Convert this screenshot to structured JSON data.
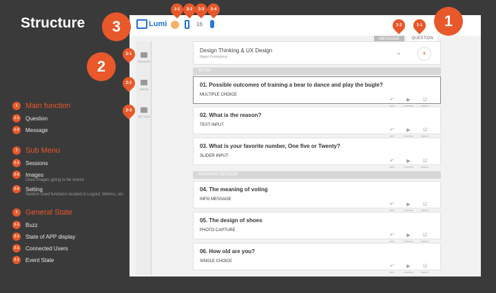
{
  "title": "Structure",
  "markers": {
    "big1": "1",
    "big2": "2",
    "big3": "3",
    "pins": [
      "1-2",
      "1-1",
      "2-1",
      "2-2",
      "2-3",
      "3-1",
      "3-2",
      "3-3",
      "3-4"
    ]
  },
  "legend": {
    "main": {
      "num": "1",
      "title": "Main function",
      "items": [
        {
          "num": "1-1",
          "label": "Question",
          "sub": ""
        },
        {
          "num": "1-2",
          "label": "Message",
          "sub": ""
        }
      ]
    },
    "submenu": {
      "num": "2",
      "title": "Sub Menu",
      "items": [
        {
          "num": "2-1",
          "label": "Sessions",
          "sub": ""
        },
        {
          "num": "2-2",
          "label": "Images",
          "sub": "Used images going to be stored"
        },
        {
          "num": "2-3",
          "label": "Setting",
          "sub": "Seldom used functions located in Logout, Metrics, etc"
        }
      ]
    },
    "general": {
      "num": "3",
      "title": "General State",
      "items": [
        {
          "num": "3-1",
          "label": "Buzz",
          "sub": ""
        },
        {
          "num": "3-1",
          "label": "State of APP display",
          "sub": ""
        },
        {
          "num": "3-1",
          "label": "Connected Users",
          "sub": ""
        },
        {
          "num": "3-1",
          "label": "Event State",
          "sub": ""
        }
      ]
    }
  },
  "app": {
    "logo": "Lumi",
    "users_count": "16",
    "tabs": {
      "message": "MESSAGE",
      "question": "QUESTION"
    },
    "sidebar": [
      "SESSION",
      "IMAGE",
      "SETTING"
    ],
    "session": {
      "title": "Design Thinking & UX Design",
      "subtitle": "Rapid Prototyping",
      "add": "+"
    },
    "sections": [
      "INTRO",
      "MORNING SESSION"
    ],
    "actions": [
      "EDIT",
      "CONTROL",
      "RESULT"
    ],
    "questions": [
      {
        "q": "01. Possible outcomes of training a bear to dance and play the bugle?",
        "type": "MULTIPLE CHOICE"
      },
      {
        "q": "02. What is the reason?",
        "type": "TEXT INPUT"
      },
      {
        "q": "03. What is your favorite number, One five or Twenty?",
        "type": "SLIDER INPUT"
      },
      {
        "q": "04. The meaning of voting",
        "type": "INFO MESSAGE"
      },
      {
        "q": "05. The design of shoes",
        "type": "PHOTO CAPTURE"
      },
      {
        "q": "06. How old are you?",
        "type": "SINGLE CHOICE"
      }
    ]
  }
}
